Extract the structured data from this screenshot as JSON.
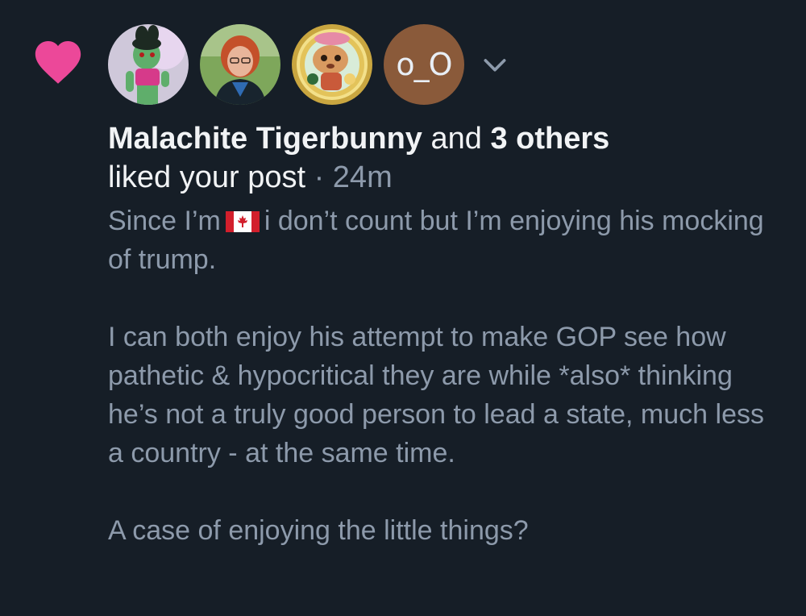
{
  "notification": {
    "icon": "heart-icon",
    "icon_color": "#ec4899",
    "avatars": [
      {
        "name": "avatar-green-bunny"
      },
      {
        "name": "avatar-red-hair-person"
      },
      {
        "name": "avatar-cartoon-character"
      },
      {
        "name": "avatar-text",
        "text": "o_O"
      }
    ],
    "expand_icon": "chevron-down-icon",
    "actor": "Malachite Tigerbunny",
    "connector": "and",
    "others": "3 others",
    "action": "liked your post",
    "separator": "·",
    "time": "24m",
    "post": {
      "line1_before_flag": "Since I’m",
      "flag": "canada-flag-icon",
      "line1_after_flag": "i don’t count but I’m enjoying his mocking of trump.",
      "paragraph2": "I can both enjoy his attempt to make GOP see how pathetic & hypocritical they are while *also* thinking he’s not a truly good person to lead a state, much less a country - at the same time.",
      "paragraph3": "A case of enjoying the little things?"
    }
  }
}
